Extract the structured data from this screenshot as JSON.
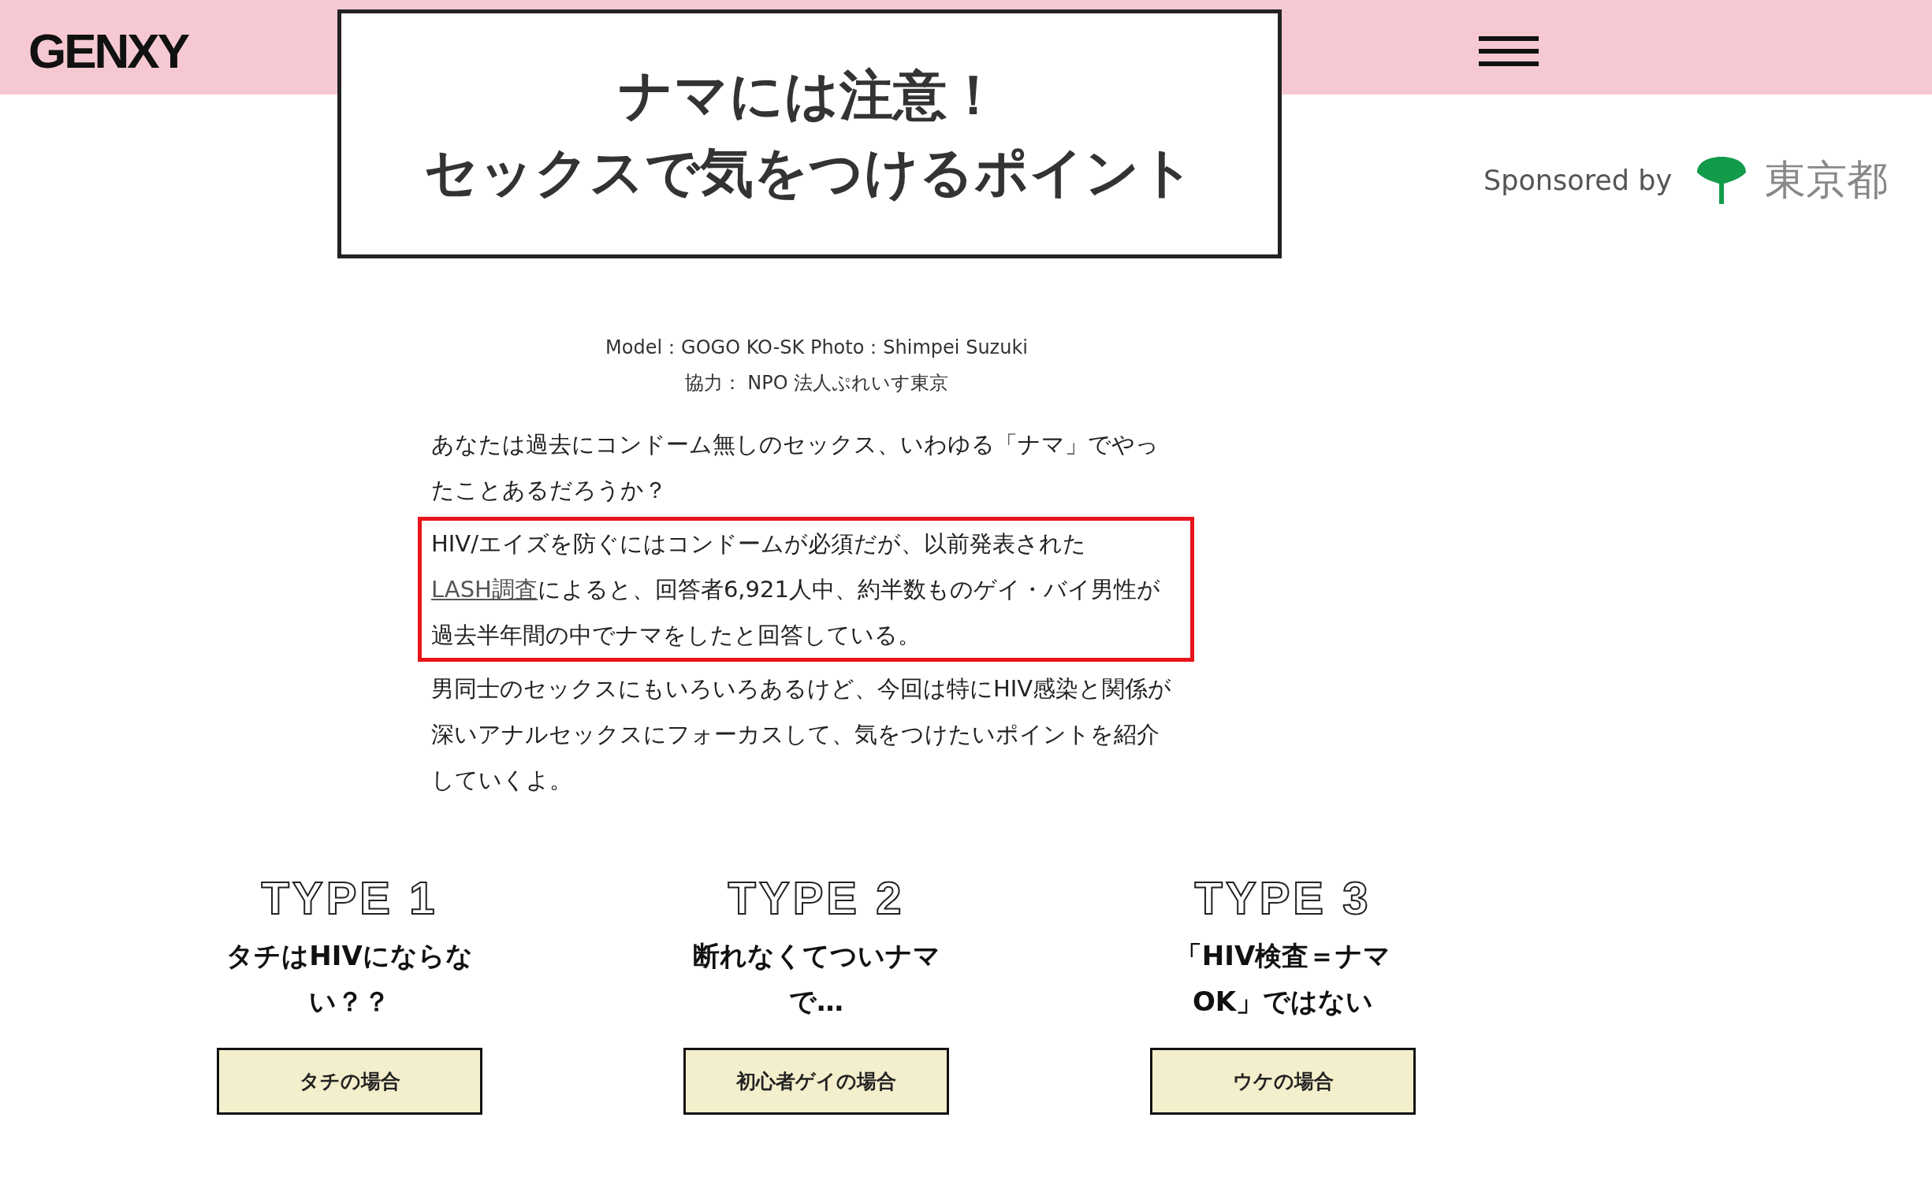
{
  "header": {
    "logo": "GENXY"
  },
  "title_box": {
    "lines": [
      "ナマには注意！",
      "セックスで気をつけるポイント"
    ]
  },
  "sponsor": {
    "label": "Sponsored by",
    "name": "東京都"
  },
  "credits": [
    "Model：GOGO KO-SK Photo：Shimpei Suzuki",
    "協力： NPO 法人ぷれいす東京"
  ],
  "body": [
    {
      "highlighted": false,
      "parts": [
        {
          "kind": "text",
          "text": "あなたは過去にコンドーム無しのセックス、いわゆる「ナマ」でやったことあるだろうか？"
        }
      ]
    },
    {
      "highlighted": true,
      "parts": [
        {
          "kind": "text",
          "text": "HIV/エイズを防ぐにはコンドームが必須だが、以前発表された"
        },
        {
          "kind": "link",
          "text": "LASH調査"
        },
        {
          "kind": "text",
          "text": "によると、回答者6,921人中、約半数ものゲイ・バイ男性が過去半年間の中でナマをしたと回答している。"
        }
      ]
    },
    {
      "highlighted": false,
      "parts": [
        {
          "kind": "text",
          "text": "男同士のセックスにもいろいろあるけど、今回は特にHIV感染と関係が深いアナルセックスにフォーカスして、気をつけたいポイントを紹介していくよ。"
        }
      ]
    }
  ],
  "types": [
    {
      "heading": "TYPE 1",
      "title_lines": [
        "タチはHIVにならな",
        "い？？"
      ],
      "button": "タチの場合"
    },
    {
      "heading": "TYPE 2",
      "title_lines": [
        "断れなくてついナマ",
        "で…"
      ],
      "button": "初心者ゲイの場合"
    },
    {
      "heading": "TYPE 3",
      "title_lines": [
        "「HIV検査＝ナマ",
        "OK」ではない"
      ],
      "button": "ウケの場合"
    }
  ]
}
